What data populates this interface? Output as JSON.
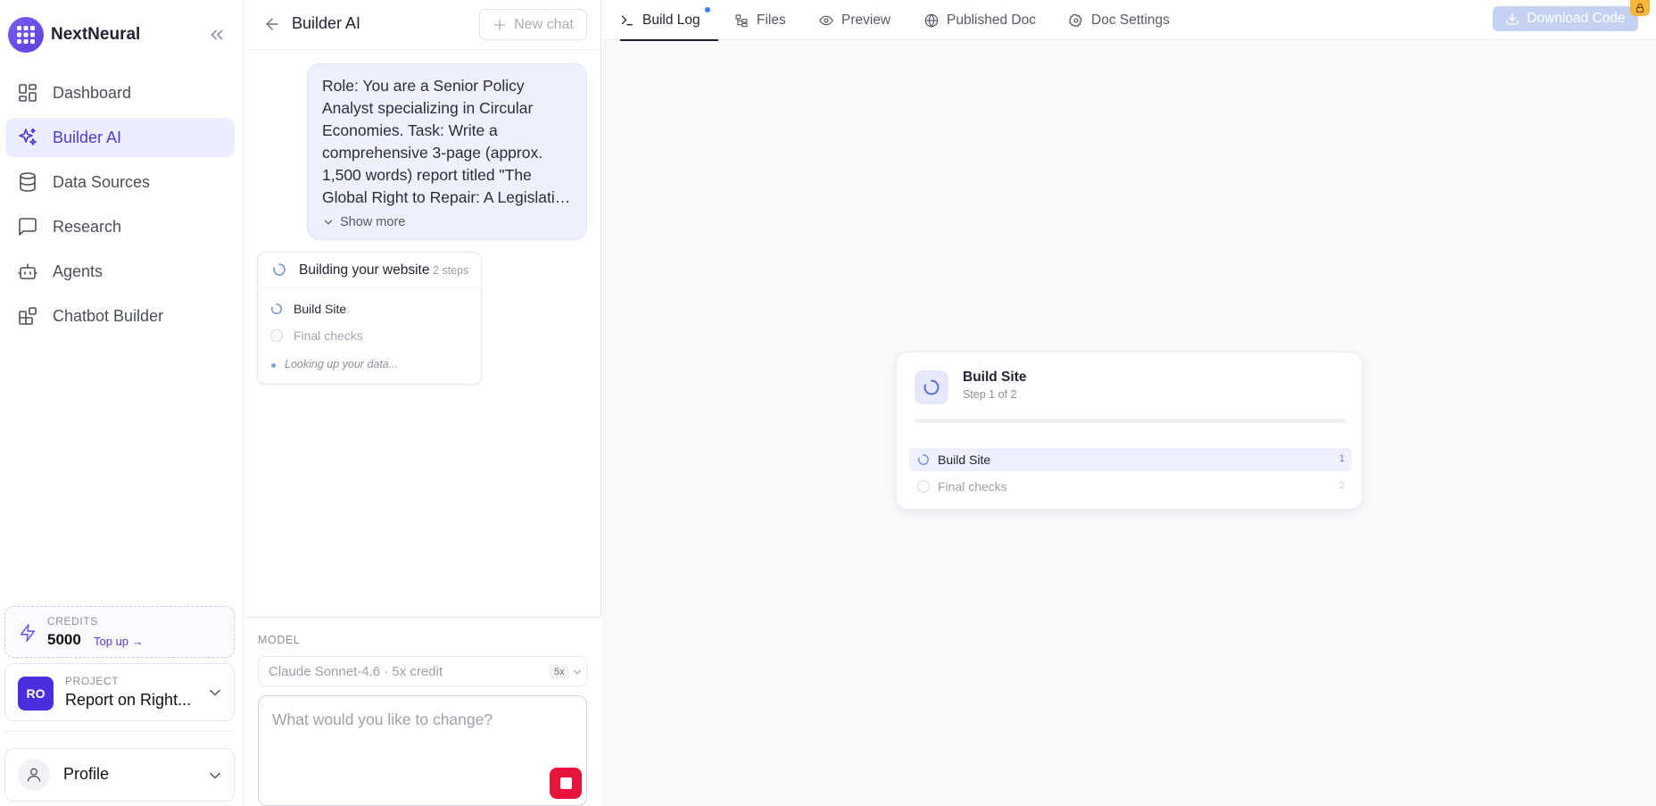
{
  "brand": {
    "name": "NextNeural"
  },
  "sidebar": {
    "items": [
      {
        "label": "Dashboard",
        "icon": "dashboard-icon",
        "active": false
      },
      {
        "label": "Builder AI",
        "icon": "sparkles-icon",
        "active": true
      },
      {
        "label": "Data Sources",
        "icon": "database-icon",
        "active": false
      },
      {
        "label": "Research",
        "icon": "message-square-icon",
        "active": false
      },
      {
        "label": "Agents",
        "icon": "bot-icon",
        "active": false
      },
      {
        "label": "Chatbot Builder",
        "icon": "blocks-icon",
        "active": false
      }
    ],
    "credits": {
      "label": "CREDITS",
      "value": "5000",
      "topup": "Top up →"
    },
    "project": {
      "label": "PROJECT",
      "initials": "RO",
      "name": "Report on Right..."
    },
    "profile": {
      "label": "Profile"
    }
  },
  "chat": {
    "title": "Builder AI",
    "new_chat": "New chat",
    "user_message": "Role: You are a Senior Policy Analyst specializing in Circular Economies. Task: Write a comprehensive 3-page (approx. 1,500 words) report titled \"The Global Right to Repair: A Legislative Blueprint for Curbing th...",
    "show_more": "Show more",
    "progress": {
      "title": "Building your website",
      "steps_count": "2 steps",
      "steps": [
        {
          "label": "Build Site",
          "state": "running"
        },
        {
          "label": "Final checks",
          "state": "pending"
        }
      ],
      "status": "Looking up your data..."
    },
    "model": {
      "label": "MODEL",
      "value": "Claude Sonnet-4.6 · 5x credit",
      "badge": "5x"
    },
    "prompt": {
      "placeholder": "What would you like to change?"
    }
  },
  "tabs": [
    {
      "label": "Build Log",
      "icon": "terminal-icon",
      "active": true
    },
    {
      "label": "Files",
      "icon": "file-tree-icon",
      "active": false
    },
    {
      "label": "Preview",
      "icon": "eye-icon",
      "active": false
    },
    {
      "label": "Published Doc",
      "icon": "globe-icon",
      "active": false
    },
    {
      "label": "Doc Settings",
      "icon": "gear-icon",
      "active": false
    }
  ],
  "download": {
    "label": "Download Code"
  },
  "build": {
    "title": "Build Site",
    "subtitle": "Step 1 of 2",
    "progress": 0,
    "steps": [
      {
        "label": "Build Site",
        "number": "1",
        "state": "active"
      },
      {
        "label": "Final checks",
        "number": "2",
        "state": "pending"
      }
    ]
  },
  "colors": {
    "accent": "#4b3bd6",
    "stop": "#e8143c",
    "download_disabled": "#c3d2f3",
    "lock": "#f4b73a"
  }
}
